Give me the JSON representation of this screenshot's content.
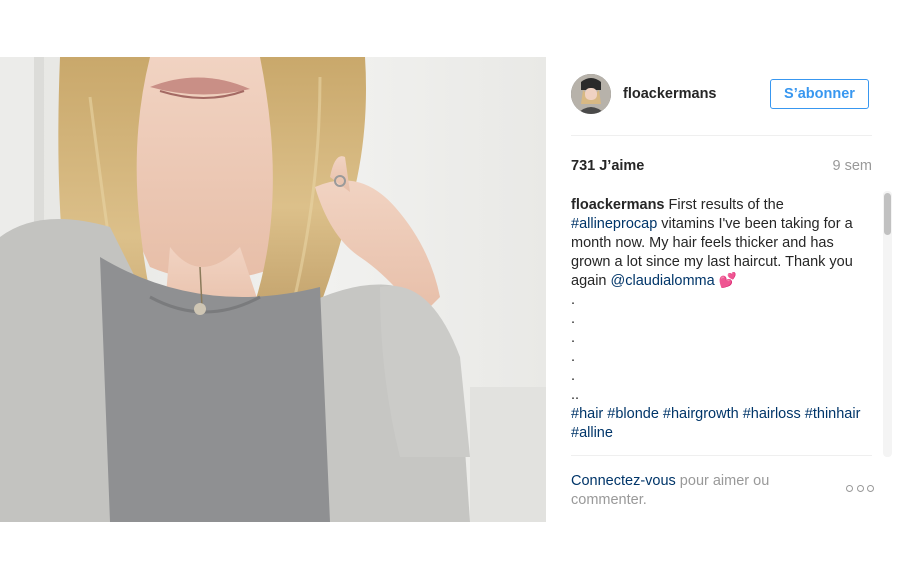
{
  "post": {
    "image_alt": "Photo of a woman with blonde hair wearing a grey sweater and cardigan",
    "author": {
      "username": "floackermans",
      "follow_label": "S’abonner"
    },
    "likes": "731 J’aime",
    "age": "9 sem",
    "caption": {
      "username": "floackermans",
      "text_1": " First results of the ",
      "hashtag_1": "#allineprocap",
      "text_2": " vitamins I've been taking for a month now. My hair feels thicker and has grown a lot since my last haircut. Thank you again ",
      "mention": "@claudialomma",
      "emoji": "💕",
      "dots": [
        ".",
        ".",
        ".",
        ".",
        ".",
        ".."
      ],
      "hashtags": [
        "#hair",
        "#blonde",
        "#hairgrowth",
        "#hairloss",
        "#thinhair",
        "#alline"
      ]
    },
    "next_comment_partial": "_ _ _ _ _ _ _ _ _ _ _ _ _ _ _",
    "login_prompt": {
      "link": "Connectez-vous",
      "text": " pour aimer ou commenter."
    }
  }
}
